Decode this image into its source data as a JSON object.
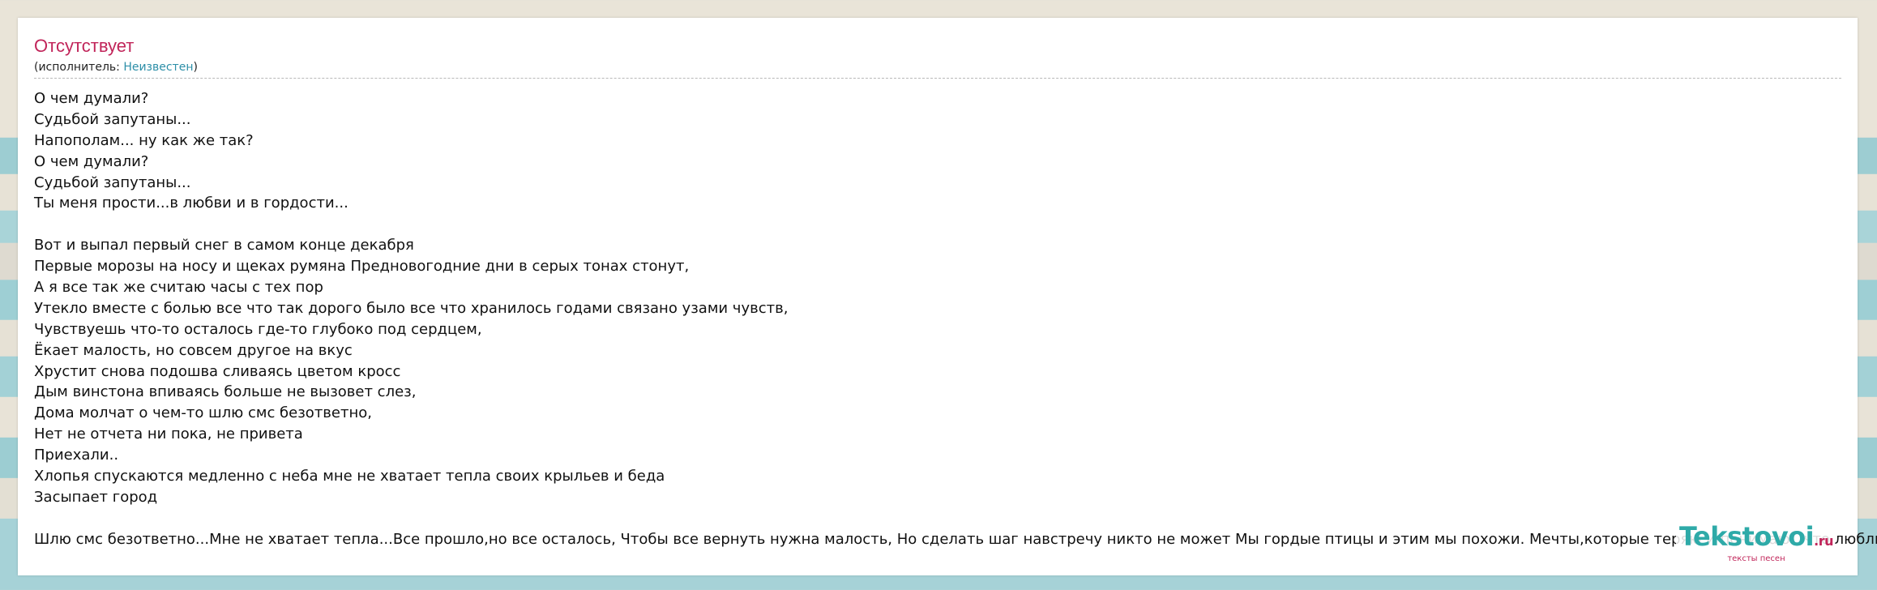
{
  "song": {
    "title": "Отсутствует",
    "artist_prefix": "(исполнитель: ",
    "artist_name": "Неизвестен",
    "artist_suffix": ")"
  },
  "lyrics": [
    "О чем думали?",
    "Судьбой запутаны...",
    "Напополам... ну как же так?",
    "О чем думали?",
    "Судьбой запутаны...",
    "Ты меня прости...в любви и в гордости...",
    "",
    "Вот и выпал первый снег в самом конце декабря",
    "Первые морозы на носу и щеках румяна Предновогодние дни в серых тонах стонут,",
    "А я все так же считаю часы с тех пор",
    "Утекло вместе с болью все что так дорого было все что хранилось годами связано узами чувств,",
    "Чувствуешь что-то осталось где-то глубоко под сердцем,",
    "Ёкает малость, но совсем другое на вкус",
    "Хрустит снова подошва сливаясь цветом кросс",
    "Дым винстона впиваясь больше не вызовет слез,",
    "Дома молчат о чем-то шлю смс безответно,",
    "Нет не отчета ни пока, не привета",
    "Приехали..",
    "Хлопья спускаются медленно с неба мне не хватает тепла своих крыльев и беда",
    "Засыпает город",
    "",
    "Шлю смс безответно...Мне не хватает тепла...Все прошло,но все осталось, Чтобы все вернуть нужна малость, Но сделать шаг навстречу никто не может Мы гордые птицы и этим мы похожи. Мечты,которые теряю и понимаю...что люблю...."
  ],
  "logo": {
    "brand": "Tekstovoi",
    "tld": ".ru",
    "tagline": "тексты песен"
  },
  "colors": {
    "title": "#c1255a",
    "link": "#2d8fa8",
    "logo_brand": "#2eaaa8",
    "logo_accent": "#c1255a"
  }
}
